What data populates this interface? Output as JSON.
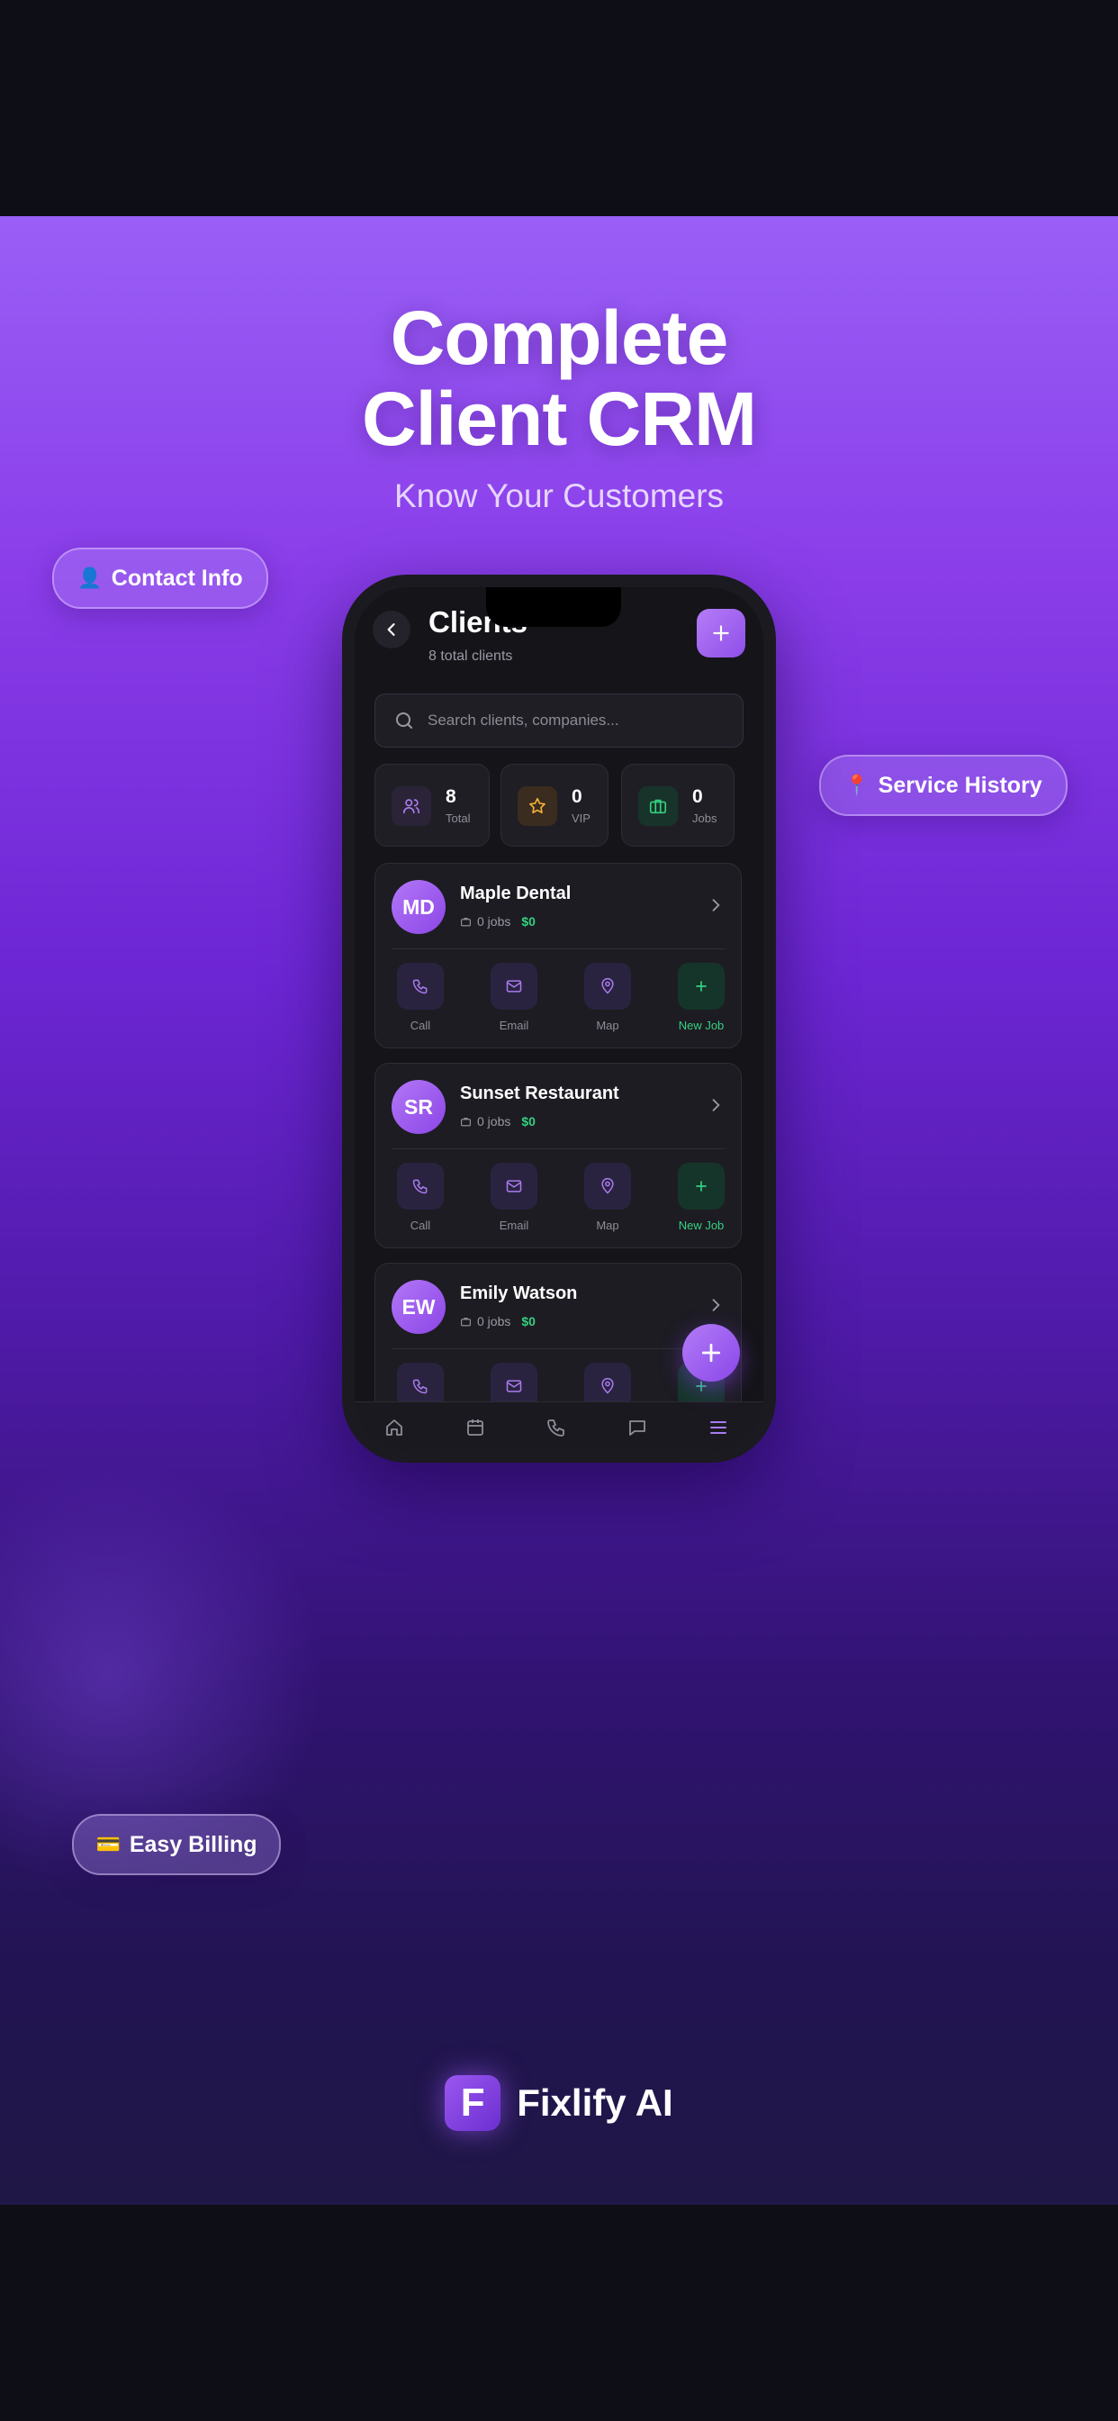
{
  "poster": {
    "headline_line1": "Complete",
    "headline_line2": "Client CRM",
    "subheadline": "Know Your Customers",
    "pills": [
      {
        "emoji": "👤",
        "label": "Contact Info"
      },
      {
        "emoji": "📍",
        "label": "Service History"
      },
      {
        "emoji": "💳",
        "label": "Easy Billing"
      }
    ],
    "brand": {
      "logo_letter": "F",
      "name": "Fixlify AI"
    }
  },
  "app": {
    "title": "Clients",
    "subtitle": "8 total clients",
    "search_placeholder": "Search clients, companies...",
    "stats": [
      {
        "value": "8",
        "label": "Total",
        "icon": "users-icon"
      },
      {
        "value": "0",
        "label": "VIP",
        "icon": "star-icon"
      },
      {
        "value": "0",
        "label": "Jobs",
        "icon": "briefcase-icon"
      }
    ],
    "clients": [
      {
        "initials": "MD",
        "name": "Maple Dental",
        "jobs": "0 jobs",
        "amount": "$0"
      },
      {
        "initials": "SR",
        "name": "Sunset Restaurant",
        "jobs": "0 jobs",
        "amount": "$0"
      },
      {
        "initials": "EW",
        "name": "Emily Watson",
        "jobs": "0 jobs",
        "amount": "$0"
      }
    ],
    "actions": {
      "call": "Call",
      "email": "Email",
      "map": "Map",
      "new_job": "New Job"
    },
    "nav": [
      "home-icon",
      "calendar-icon",
      "phone-icon",
      "message-icon",
      "menu-icon"
    ],
    "colors": {
      "accent": "#9b57f0",
      "money": "#35d07f",
      "background": "#151419"
    }
  }
}
